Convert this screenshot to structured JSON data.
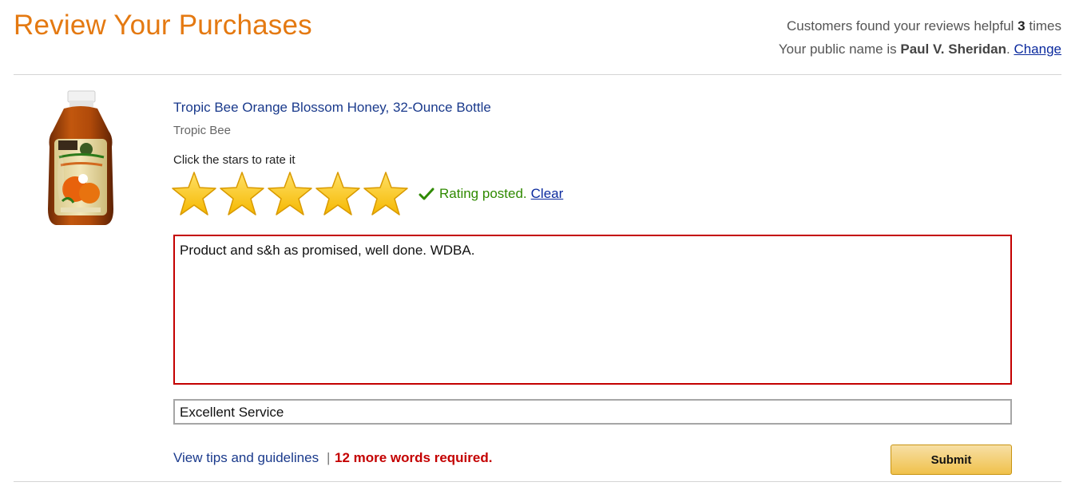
{
  "header": {
    "title": "Review Your Purchases",
    "helpful_prefix": "Customers found your reviews helpful",
    "helpful_count": "3",
    "helpful_suffix": "times",
    "public_prefix": "Your public name is",
    "public_name": "Paul V. Sheridan",
    "public_suffix": ".",
    "change_label": "Change"
  },
  "product": {
    "title": "Tropic Bee Orange Blossom Honey, 32-Ounce Bottle",
    "brand": "Tropic Bee",
    "image_label": "TROPIC BEE Florida Orange Blossom Honey",
    "image_icon": "honey-bottle-image"
  },
  "rating": {
    "hint": "Click the stars to rate it",
    "stars_selected": 5,
    "stars_total": 5,
    "star_color": "#f5b800",
    "status_text": "Rating posted.",
    "clear_label": "Clear"
  },
  "review": {
    "text": "Product and s&h as promised, well done. WDBA.",
    "headline": "Excellent Service"
  },
  "footer": {
    "tips_label": "View tips and guidelines",
    "separator": "|",
    "words_required": "12 more words required.",
    "submit_label": "Submit"
  },
  "colors": {
    "title_orange": "#e47911",
    "link_blue": "#1a3a8c",
    "success_green": "#2f8a00",
    "error_red": "#c40000",
    "button_yellow": "#f0c14b"
  }
}
